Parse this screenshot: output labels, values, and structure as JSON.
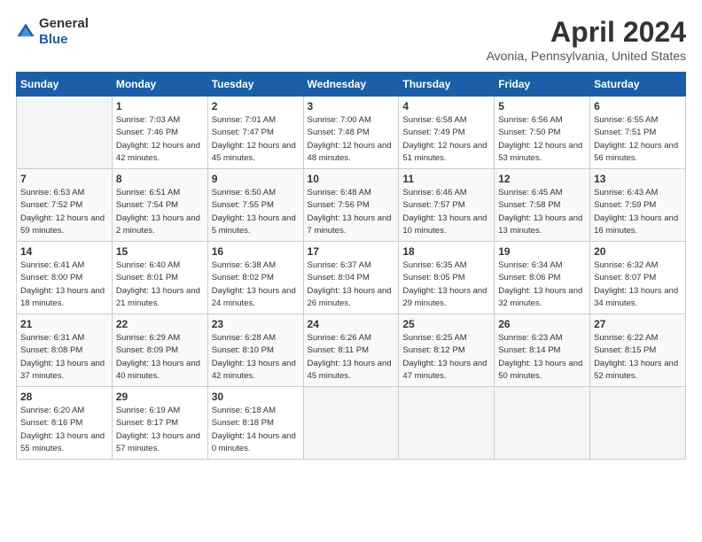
{
  "logo": {
    "general": "General",
    "blue": "Blue"
  },
  "title": "April 2024",
  "location": "Avonia, Pennsylvania, United States",
  "days_of_week": [
    "Sunday",
    "Monday",
    "Tuesday",
    "Wednesday",
    "Thursday",
    "Friday",
    "Saturday"
  ],
  "weeks": [
    [
      {
        "day": "",
        "sunrise": "",
        "sunset": "",
        "daylight": ""
      },
      {
        "day": "1",
        "sunrise": "Sunrise: 7:03 AM",
        "sunset": "Sunset: 7:46 PM",
        "daylight": "Daylight: 12 hours and 42 minutes."
      },
      {
        "day": "2",
        "sunrise": "Sunrise: 7:01 AM",
        "sunset": "Sunset: 7:47 PM",
        "daylight": "Daylight: 12 hours and 45 minutes."
      },
      {
        "day": "3",
        "sunrise": "Sunrise: 7:00 AM",
        "sunset": "Sunset: 7:48 PM",
        "daylight": "Daylight: 12 hours and 48 minutes."
      },
      {
        "day": "4",
        "sunrise": "Sunrise: 6:58 AM",
        "sunset": "Sunset: 7:49 PM",
        "daylight": "Daylight: 12 hours and 51 minutes."
      },
      {
        "day": "5",
        "sunrise": "Sunrise: 6:56 AM",
        "sunset": "Sunset: 7:50 PM",
        "daylight": "Daylight: 12 hours and 53 minutes."
      },
      {
        "day": "6",
        "sunrise": "Sunrise: 6:55 AM",
        "sunset": "Sunset: 7:51 PM",
        "daylight": "Daylight: 12 hours and 56 minutes."
      }
    ],
    [
      {
        "day": "7",
        "sunrise": "Sunrise: 6:53 AM",
        "sunset": "Sunset: 7:52 PM",
        "daylight": "Daylight: 12 hours and 59 minutes."
      },
      {
        "day": "8",
        "sunrise": "Sunrise: 6:51 AM",
        "sunset": "Sunset: 7:54 PM",
        "daylight": "Daylight: 13 hours and 2 minutes."
      },
      {
        "day": "9",
        "sunrise": "Sunrise: 6:50 AM",
        "sunset": "Sunset: 7:55 PM",
        "daylight": "Daylight: 13 hours and 5 minutes."
      },
      {
        "day": "10",
        "sunrise": "Sunrise: 6:48 AM",
        "sunset": "Sunset: 7:56 PM",
        "daylight": "Daylight: 13 hours and 7 minutes."
      },
      {
        "day": "11",
        "sunrise": "Sunrise: 6:46 AM",
        "sunset": "Sunset: 7:57 PM",
        "daylight": "Daylight: 13 hours and 10 minutes."
      },
      {
        "day": "12",
        "sunrise": "Sunrise: 6:45 AM",
        "sunset": "Sunset: 7:58 PM",
        "daylight": "Daylight: 13 hours and 13 minutes."
      },
      {
        "day": "13",
        "sunrise": "Sunrise: 6:43 AM",
        "sunset": "Sunset: 7:59 PM",
        "daylight": "Daylight: 13 hours and 16 minutes."
      }
    ],
    [
      {
        "day": "14",
        "sunrise": "Sunrise: 6:41 AM",
        "sunset": "Sunset: 8:00 PM",
        "daylight": "Daylight: 13 hours and 18 minutes."
      },
      {
        "day": "15",
        "sunrise": "Sunrise: 6:40 AM",
        "sunset": "Sunset: 8:01 PM",
        "daylight": "Daylight: 13 hours and 21 minutes."
      },
      {
        "day": "16",
        "sunrise": "Sunrise: 6:38 AM",
        "sunset": "Sunset: 8:02 PM",
        "daylight": "Daylight: 13 hours and 24 minutes."
      },
      {
        "day": "17",
        "sunrise": "Sunrise: 6:37 AM",
        "sunset": "Sunset: 8:04 PM",
        "daylight": "Daylight: 13 hours and 26 minutes."
      },
      {
        "day": "18",
        "sunrise": "Sunrise: 6:35 AM",
        "sunset": "Sunset: 8:05 PM",
        "daylight": "Daylight: 13 hours and 29 minutes."
      },
      {
        "day": "19",
        "sunrise": "Sunrise: 6:34 AM",
        "sunset": "Sunset: 8:06 PM",
        "daylight": "Daylight: 13 hours and 32 minutes."
      },
      {
        "day": "20",
        "sunrise": "Sunrise: 6:32 AM",
        "sunset": "Sunset: 8:07 PM",
        "daylight": "Daylight: 13 hours and 34 minutes."
      }
    ],
    [
      {
        "day": "21",
        "sunrise": "Sunrise: 6:31 AM",
        "sunset": "Sunset: 8:08 PM",
        "daylight": "Daylight: 13 hours and 37 minutes."
      },
      {
        "day": "22",
        "sunrise": "Sunrise: 6:29 AM",
        "sunset": "Sunset: 8:09 PM",
        "daylight": "Daylight: 13 hours and 40 minutes."
      },
      {
        "day": "23",
        "sunrise": "Sunrise: 6:28 AM",
        "sunset": "Sunset: 8:10 PM",
        "daylight": "Daylight: 13 hours and 42 minutes."
      },
      {
        "day": "24",
        "sunrise": "Sunrise: 6:26 AM",
        "sunset": "Sunset: 8:11 PM",
        "daylight": "Daylight: 13 hours and 45 minutes."
      },
      {
        "day": "25",
        "sunrise": "Sunrise: 6:25 AM",
        "sunset": "Sunset: 8:12 PM",
        "daylight": "Daylight: 13 hours and 47 minutes."
      },
      {
        "day": "26",
        "sunrise": "Sunrise: 6:23 AM",
        "sunset": "Sunset: 8:14 PM",
        "daylight": "Daylight: 13 hours and 50 minutes."
      },
      {
        "day": "27",
        "sunrise": "Sunrise: 6:22 AM",
        "sunset": "Sunset: 8:15 PM",
        "daylight": "Daylight: 13 hours and 52 minutes."
      }
    ],
    [
      {
        "day": "28",
        "sunrise": "Sunrise: 6:20 AM",
        "sunset": "Sunset: 8:16 PM",
        "daylight": "Daylight: 13 hours and 55 minutes."
      },
      {
        "day": "29",
        "sunrise": "Sunrise: 6:19 AM",
        "sunset": "Sunset: 8:17 PM",
        "daylight": "Daylight: 13 hours and 57 minutes."
      },
      {
        "day": "30",
        "sunrise": "Sunrise: 6:18 AM",
        "sunset": "Sunset: 8:18 PM",
        "daylight": "Daylight: 14 hours and 0 minutes."
      },
      {
        "day": "",
        "sunrise": "",
        "sunset": "",
        "daylight": ""
      },
      {
        "day": "",
        "sunrise": "",
        "sunset": "",
        "daylight": ""
      },
      {
        "day": "",
        "sunrise": "",
        "sunset": "",
        "daylight": ""
      },
      {
        "day": "",
        "sunrise": "",
        "sunset": "",
        "daylight": ""
      }
    ]
  ]
}
